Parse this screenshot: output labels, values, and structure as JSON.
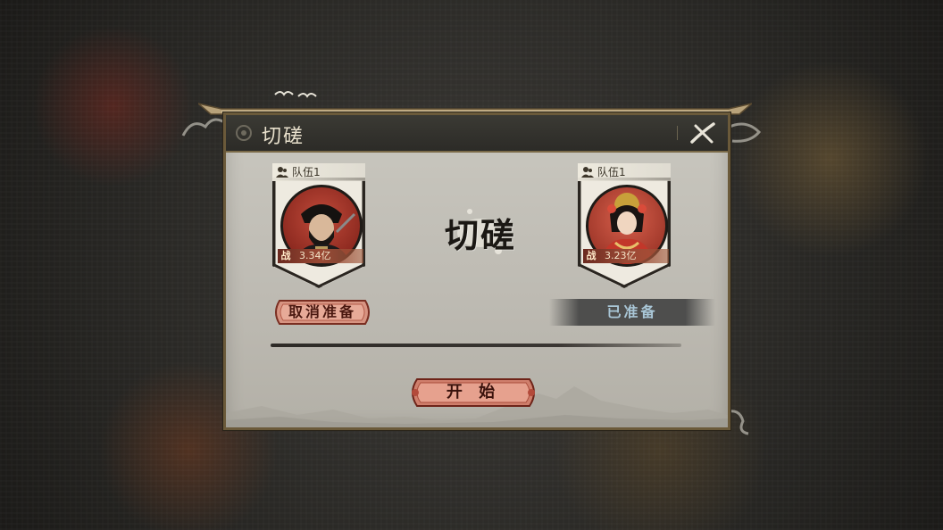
{
  "dialog": {
    "title": "切磋",
    "center_title": "切磋",
    "close_icon": "close-brush-icon"
  },
  "players": [
    {
      "team_label": "队伍1",
      "power_badge": "战",
      "power_value": "3.34亿",
      "status_label": "取消准备",
      "portrait": "warrior-portrait"
    },
    {
      "team_label": "队伍1",
      "power_badge": "战",
      "power_value": "3.23亿",
      "status_label": "已准备",
      "portrait": "lady-portrait"
    }
  ],
  "actions": {
    "start_label": "开 始"
  },
  "colors": {
    "accent_red": "#b4473a",
    "panel": "#c4c1b9",
    "title_bar": "#2f2e2a",
    "ready_text": "#a9c6d6"
  }
}
